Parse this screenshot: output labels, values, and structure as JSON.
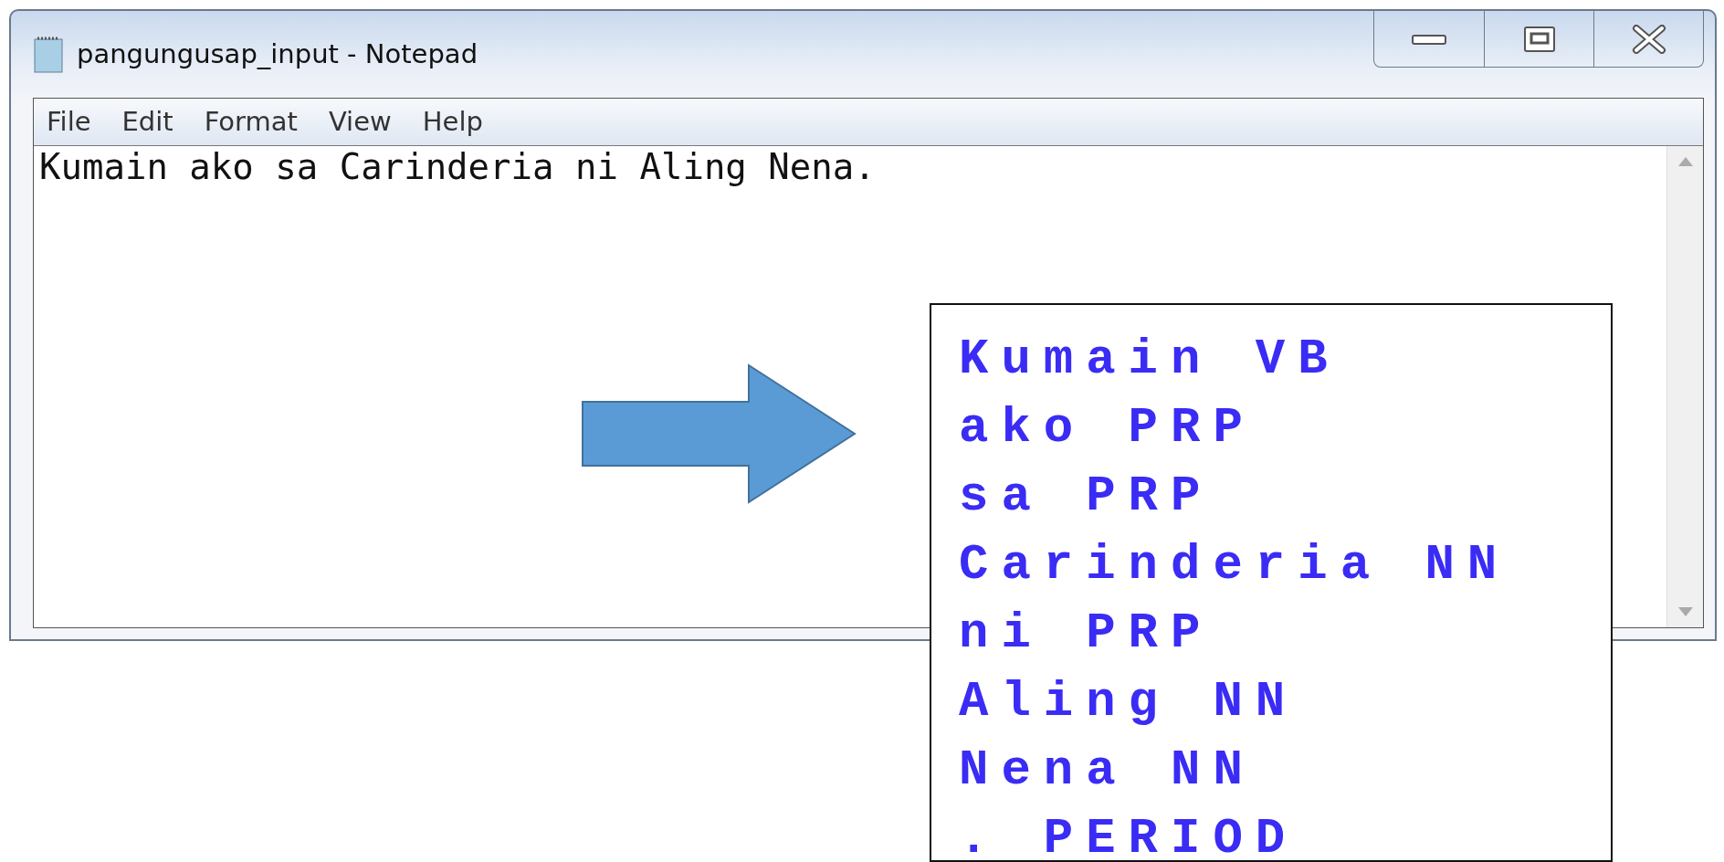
{
  "window": {
    "title": "pangungusap_input - Notepad"
  },
  "menu": [
    {
      "label": "File"
    },
    {
      "label": "Edit"
    },
    {
      "label": "Format"
    },
    {
      "label": "View"
    },
    {
      "label": "Help"
    }
  ],
  "editor": {
    "text": "Kumain ako sa Carinderia ni Aling Nena."
  },
  "output_box": {
    "lines": [
      "Kumain VB",
      "ako PRP",
      "sa PRP",
      "Carinderia NN",
      "ni PRP",
      "Aling NN",
      "Nena NN",
      ". PERIOD"
    ]
  }
}
